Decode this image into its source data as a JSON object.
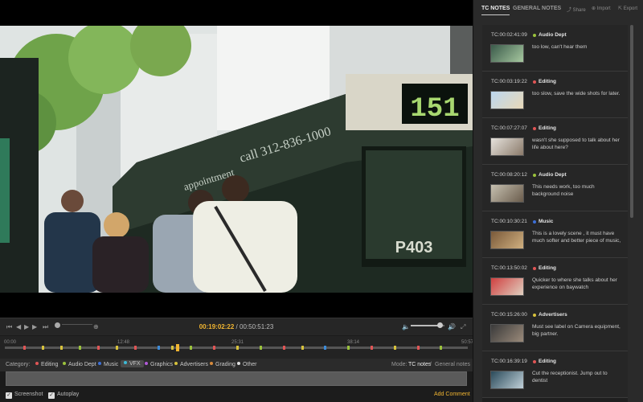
{
  "player": {
    "current_tc": "00:19:02:22",
    "separator": "/",
    "total_tc": "00:50:51:23",
    "volume_fraction": 0.85,
    "bus_display": "151",
    "bus_plate": "P403",
    "bus_ad": "call 312-836-1000",
    "bus_ad_prefix": "appointment"
  },
  "timeline": {
    "labels": [
      "00:00",
      "12:48",
      "25:31",
      "38:14",
      "50:57"
    ],
    "playhead_fraction": 0.374,
    "markers": [
      {
        "pos": 0.04,
        "color": "#e05555"
      },
      {
        "pos": 0.08,
        "color": "#d7c23c"
      },
      {
        "pos": 0.12,
        "color": "#d7c23c"
      },
      {
        "pos": 0.16,
        "color": "#9ac23c"
      },
      {
        "pos": 0.2,
        "color": "#e05555"
      },
      {
        "pos": 0.24,
        "color": "#d7c23c"
      },
      {
        "pos": 0.28,
        "color": "#e05555"
      },
      {
        "pos": 0.33,
        "color": "#3c8ad7"
      },
      {
        "pos": 0.36,
        "color": "#d7c23c"
      },
      {
        "pos": 0.4,
        "color": "#9ac23c"
      },
      {
        "pos": 0.45,
        "color": "#e05555"
      },
      {
        "pos": 0.5,
        "color": "#d7c23c"
      },
      {
        "pos": 0.55,
        "color": "#9ac23c"
      },
      {
        "pos": 0.6,
        "color": "#e05555"
      },
      {
        "pos": 0.64,
        "color": "#d7c23c"
      },
      {
        "pos": 0.69,
        "color": "#3c8ad7"
      },
      {
        "pos": 0.74,
        "color": "#9ac23c"
      },
      {
        "pos": 0.79,
        "color": "#e05555"
      },
      {
        "pos": 0.84,
        "color": "#d7c23c"
      },
      {
        "pos": 0.89,
        "color": "#e05555"
      },
      {
        "pos": 0.94,
        "color": "#9ac23c"
      }
    ]
  },
  "category_bar": {
    "label": "Category:",
    "categories": [
      {
        "name": "Editing",
        "color": "#e05555"
      },
      {
        "name": "Audio Dept",
        "color": "#9ac23c"
      },
      {
        "name": "Music",
        "color": "#3c6fd7"
      },
      {
        "name": "VFX",
        "color": "#3cbad7",
        "selected": true
      },
      {
        "name": "Graphics",
        "color": "#b05ad7"
      },
      {
        "name": "Advertisers",
        "color": "#d7c23c"
      },
      {
        "name": "Grading",
        "color": "#d78a3c"
      },
      {
        "name": "Other",
        "color": "#dddddd"
      }
    ],
    "mode_label": "Mode:",
    "mode_tc": "TC notes",
    "mode_sep": "/",
    "mode_general": "General notes"
  },
  "bottom": {
    "screenshot_label": "Screenshot",
    "autoplay_label": "Autoplay",
    "add_comment_label": "Add Comment"
  },
  "panel": {
    "tab_tc": "TC NOTES",
    "tab_general": "GENERAL NOTES",
    "share": "Share",
    "import": "Import",
    "export": "Export",
    "notes": [
      {
        "tc": "TC:00:02:41:09",
        "category": "Audio Dept",
        "color": "#9ac23c",
        "text": "too low, can't hear them",
        "thumb": [
          "#3a5a4a",
          "#a7c8a0"
        ]
      },
      {
        "tc": "TC:00:03:19:22",
        "category": "Editing",
        "color": "#e05555",
        "text": "too slow, save the wide shots for later.",
        "thumb": [
          "#bcd7ef",
          "#e8d8b8"
        ]
      },
      {
        "tc": "TC:00:07:27:07",
        "category": "Editing",
        "color": "#e05555",
        "text": "wasn't she supposed to talk about her life about here?",
        "thumb": [
          "#e6e2dc",
          "#8a7a6a"
        ]
      },
      {
        "tc": "TC:00:08:20:12",
        "category": "Audio Dept",
        "color": "#9ac23c",
        "text": "This needs work, too much background noise",
        "thumb": [
          "#c6c0b0",
          "#6a5c4c"
        ]
      },
      {
        "tc": "TC:00:10:30:21",
        "category": "Music",
        "color": "#3c6fd7",
        "text": "This is a lovely scene , it must have much softer and better piece of music,",
        "thumb": [
          "#7a5a3a",
          "#d0b080"
        ]
      },
      {
        "tc": "TC:00:13:50:02",
        "category": "Editing",
        "color": "#e05555",
        "text": "Quicker to where she talks about her experience on baywatch",
        "thumb": [
          "#d04040",
          "#e0d0c0"
        ]
      },
      {
        "tc": "TC:00:15:26:00",
        "category": "Advertisers",
        "color": "#d7c23c",
        "text": "Must see label on Camera equipment, big partner.",
        "thumb": [
          "#3a3a3a",
          "#9a8a7a"
        ]
      },
      {
        "tc": "TC:00:16:39:19",
        "category": "Editing",
        "color": "#e05555",
        "text": "Cut the receptionist. Jump out to dentist",
        "thumb": [
          "#2a4a5a",
          "#c0d0d8"
        ]
      }
    ]
  }
}
